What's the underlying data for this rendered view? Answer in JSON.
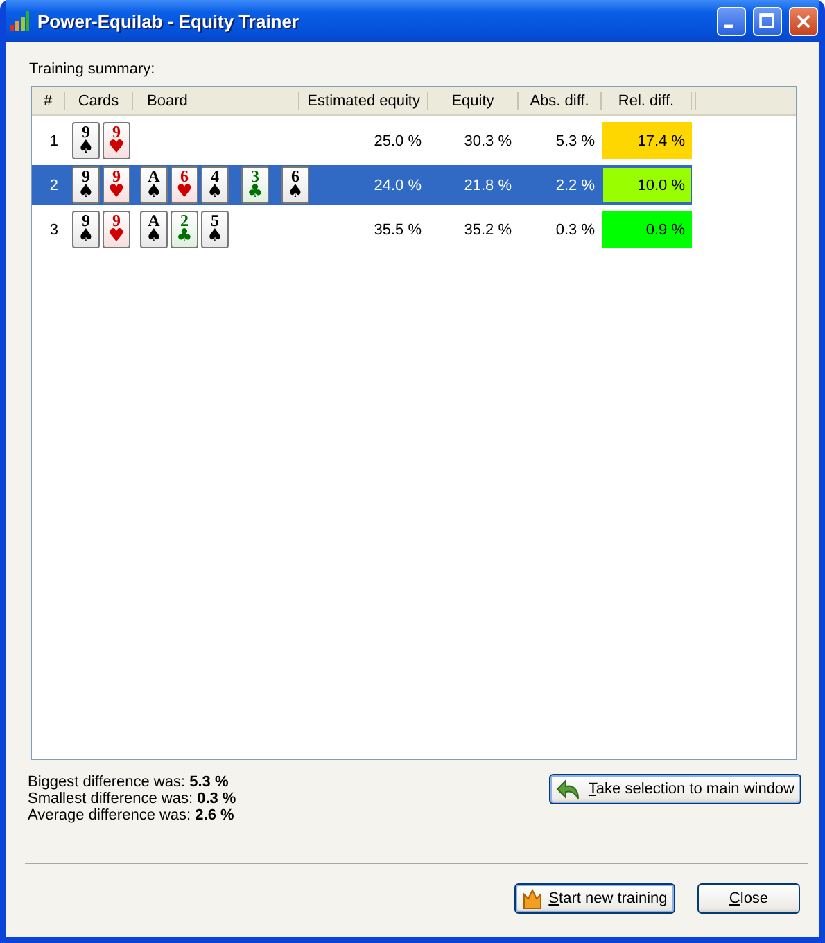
{
  "window": {
    "title": "Power-Equilab - Equity Trainer"
  },
  "section_label": "Training summary:",
  "table": {
    "columns": [
      "#",
      "Cards",
      "Board",
      "Estimated equity",
      "Equity",
      "Abs. diff.",
      "Rel. diff."
    ],
    "rows": [
      {
        "index": "1",
        "selected": false,
        "cards": [
          {
            "rank": "9",
            "suit": "♠",
            "kind": "spade"
          },
          {
            "rank": "9",
            "suit": "♥",
            "kind": "heart"
          }
        ],
        "board": [],
        "estimated": "25.0 %",
        "equity": "30.3 %",
        "abs_diff": "5.3 %",
        "rel_diff": "17.4 %",
        "color": "#ffd700"
      },
      {
        "index": "2",
        "selected": true,
        "cards": [
          {
            "rank": "9",
            "suit": "♠",
            "kind": "spade"
          },
          {
            "rank": "9",
            "suit": "♥",
            "kind": "heart"
          }
        ],
        "board": [
          {
            "rank": "A",
            "suit": "♠",
            "kind": "spade"
          },
          {
            "rank": "6",
            "suit": "♥",
            "kind": "heart"
          },
          {
            "rank": "4",
            "suit": "♠",
            "kind": "spade"
          },
          {
            "rank": "3",
            "suit": "♣",
            "kind": "club"
          },
          {
            "rank": "6",
            "suit": "♠",
            "kind": "spade"
          }
        ],
        "estimated": "24.0 %",
        "equity": "21.8 %",
        "abs_diff": "2.2 %",
        "rel_diff": "10.0 %",
        "color": "#99ff00"
      },
      {
        "index": "3",
        "selected": false,
        "cards": [
          {
            "rank": "9",
            "suit": "♠",
            "kind": "spade"
          },
          {
            "rank": "9",
            "suit": "♥",
            "kind": "heart"
          }
        ],
        "board": [
          {
            "rank": "A",
            "suit": "♠",
            "kind": "spade"
          },
          {
            "rank": "2",
            "suit": "♣",
            "kind": "club"
          },
          {
            "rank": "5",
            "suit": "♠",
            "kind": "spade"
          }
        ],
        "estimated": "35.5 %",
        "equity": "35.2 %",
        "abs_diff": "0.3 %",
        "rel_diff": "0.9 %",
        "color": "#00ff00"
      }
    ]
  },
  "stats": [
    "Biggest difference was: **5.3 %**",
    "Smallest difference was: **0.3 %**",
    "Average difference was: **2.6 %**"
  ],
  "take_button": "Take selection to main window",
  "start_button": "Start new training",
  "close_button": "Close"
}
